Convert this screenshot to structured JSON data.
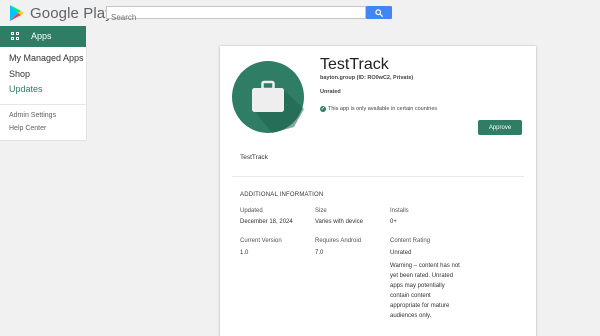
{
  "header": {
    "brand": "Google Play",
    "search": {
      "placeholder": "Search",
      "value": ""
    }
  },
  "sidebar": {
    "section_label": "Apps",
    "items": [
      {
        "label": "My Managed Apps"
      },
      {
        "label": "Shop"
      },
      {
        "label": "Updates"
      }
    ],
    "footer_items": [
      {
        "label": "Admin Settings"
      },
      {
        "label": "Help Center"
      }
    ]
  },
  "app": {
    "title": "TestTrack",
    "developer": "bayton.group (ID: RO0wC2, Private)",
    "content_rating_badge": "Unrated",
    "availability_note": "This app is only available in certain countries",
    "approve_label": "Approve",
    "description": "TestTrack",
    "icon": "briefcase-icon"
  },
  "additional_info": {
    "heading": "ADDITIONAL INFORMATION",
    "updated": {
      "label": "Updated",
      "value": "December 18, 2024"
    },
    "size": {
      "label": "Size",
      "value": "Varies with device"
    },
    "installs": {
      "label": "Installs",
      "value": "0+"
    },
    "current_version": {
      "label": "Current Version",
      "value": "1.0"
    },
    "requires_android": {
      "label": "Requires Android",
      "value": "7.0"
    },
    "content_rating": {
      "label": "Content Rating",
      "value": "Unrated",
      "warning": "Warning – content has not yet been rated. Unrated apps may potentially contain content appropriate for mature audiences only."
    }
  },
  "colors": {
    "accent": "#2e7d64",
    "search_button": "#4285f4",
    "page_bg": "#f1f1f1"
  }
}
